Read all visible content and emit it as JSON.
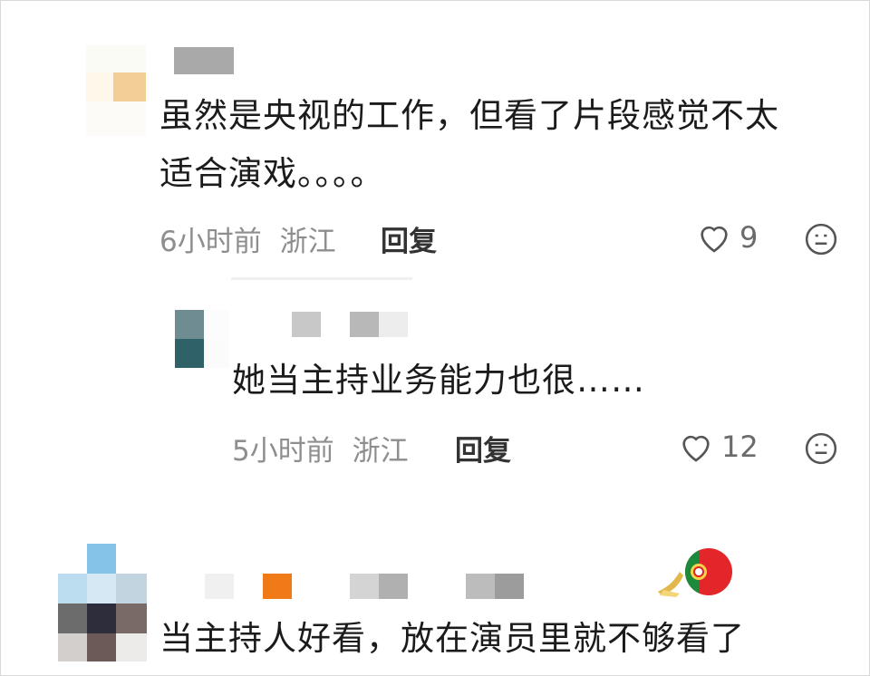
{
  "comments": [
    {
      "lines": [
        "虽然是央视的工作，但看了片段感觉不太",
        "适合演戏。。。。"
      ],
      "time": "6小时前",
      "location": "浙江",
      "reply_label": "回复",
      "likes": "9"
    },
    {
      "text": "当主持人好看，放在演员里就不够看了"
    }
  ],
  "replies": [
    {
      "text": "她当主持业务能力也很……",
      "time": "5小时前",
      "location": "浙江",
      "reply_label": "回复",
      "likes": "12"
    }
  ],
  "icons": [
    "heart-icon",
    "dislike-face-icon",
    "portugal-flag-badge-icon"
  ],
  "colors": {
    "text": "#1b1b1b",
    "meta": "#8e8e8e",
    "icon": "#555555",
    "badge_red": "#e3262a",
    "badge_green": "#1b8a3a"
  }
}
